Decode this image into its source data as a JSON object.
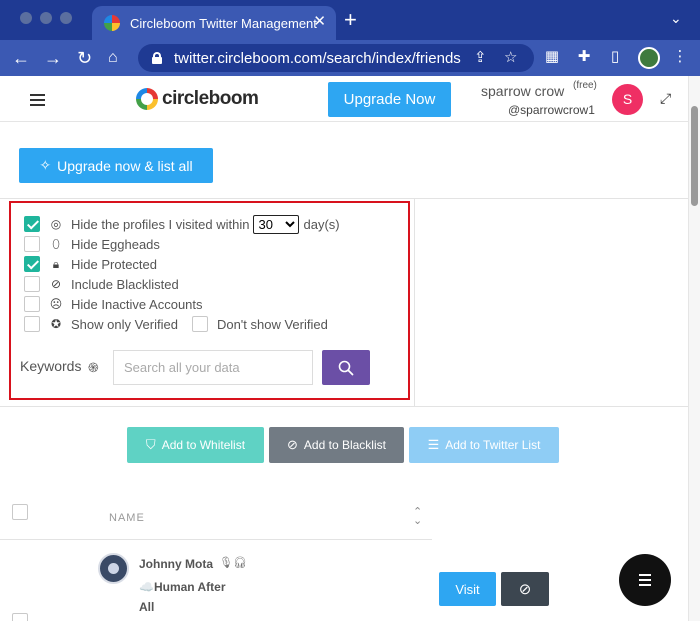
{
  "browser": {
    "tab_title": "Circleboom Twitter Management",
    "tab_close": "✕",
    "new_tab": "+",
    "url": "twitter.circleboom.com/search/index/friends"
  },
  "header": {
    "logo_text": "circleboom",
    "upgrade_button": "Upgrade Now",
    "user_name": "sparrow crow",
    "user_plan": "(free)",
    "user_handle": "@sparrowcrow1",
    "avatar_letter": "S"
  },
  "upgrade_all_button": "Upgrade now & list all",
  "filters": {
    "visited_label": "Hide the profiles I visited within",
    "visited_days": "30",
    "visited_days_options": [
      "30"
    ],
    "visited_suffix": "day(s)",
    "items": [
      {
        "label": "Hide Eggheads",
        "checked": false
      },
      {
        "label": "Hide Protected",
        "checked": true
      },
      {
        "label": "Include Blacklisted",
        "checked": false
      },
      {
        "label": "Hide Inactive Accounts",
        "checked": false
      }
    ],
    "visited_checked": true,
    "show_verified": "Show only Verified",
    "dont_show_verified": "Don't show Verified"
  },
  "keywords": {
    "label": "Keywords",
    "placeholder": "Search all your data"
  },
  "actions": {
    "whitelist": "Add to Whitelist",
    "blacklist": "Add to Blacklist",
    "twitter_list": "Add to Twitter List"
  },
  "colors": {
    "whitelist": "#5fd2c4",
    "blacklist": "#727b84",
    "twitter_list": "#8fcdf5"
  },
  "table": {
    "name_header": "NAME",
    "rows": [
      {
        "name": "Johnny Mota",
        "bio_line1": "☁️Human After",
        "bio_line2": "All",
        "visit": "Visit"
      }
    ]
  }
}
